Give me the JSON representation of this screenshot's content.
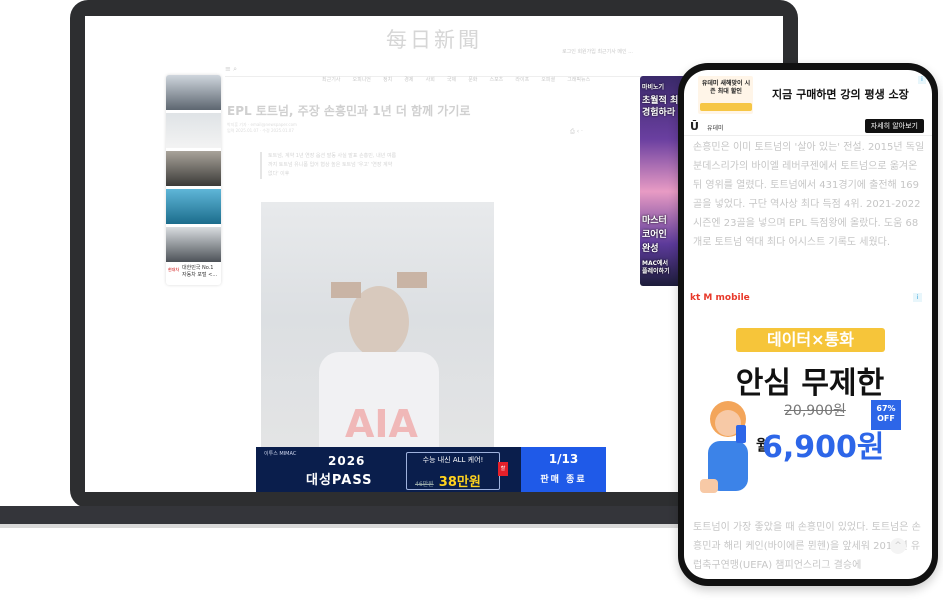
{
  "laptop": {
    "masthead": "每日新聞",
    "top_util": "로그인 회원가입 최근기사 메인 ...",
    "nav_items": [
      "최근기사",
      "오피니언",
      "정치",
      "경제",
      "사회",
      "국제",
      "문화",
      "스포츠",
      "라이프",
      "오피셜",
      "그래픽뉴스"
    ],
    "nav_icons": "≡  ⌕",
    "article_title": "EPL 토트넘, 주장 손흥민과 1년 더 함께 가기로",
    "byline_1": "박지훈 기자 · email@newspaper.com",
    "byline_2": "입력 2025.01.07 · 수정 2025.01.07",
    "share": "⎙  ‹  ·",
    "summary": "토트넘, 계약 1년 연장 옵션 발동 사실 발표 손흥민, 내년 여름까지 토트넘 유니폼 입어 협상 높은 토트넘 '우고' '연장 계약 없다' 이후",
    "left_ad": {
      "logo": "현대차",
      "text_1": "대한민국 No.1",
      "text_2": "자동차 포털 <..."
    },
    "right_ad": {
      "lines": [
        "마비노기",
        "초월적 최",
        "경험하라",
        "마스터",
        "코어인",
        "완성",
        "MAC에서",
        "플레이하기"
      ]
    },
    "bottom_banner": {
      "brand": "이투스 MIMAC",
      "year": "2026",
      "pass": "대성PASS",
      "top_text": "수능 내신 ALL 케어!",
      "old_price": "46만원",
      "new_price": "38만원",
      "badge": "할",
      "date": "1/13",
      "end_text": "판매 종료"
    }
  },
  "phone": {
    "ad": {
      "box_label": "유데미 새해맞이 시즌 최대 할인",
      "headline": "지금 구매하면 강의 평생 소장",
      "info": "i"
    },
    "brand_icon": "Ū",
    "brand": "유데미",
    "brand_button": "자세히 알아보기",
    "paragraph_1": "손흥민은 이미 토트넘의 '살아 있는' 전설. 2015년 독일 분데스리가의 바이엘 레버쿠젠에서 토트넘으로 옮겨온 뒤 영위를 열렸다. 토트넘에서 431경기에 출전해 169골을 넣었다. 구단 역사상 최다 득점 4위. 2021-2022시즌엔 23골을 넣으며 EPL 득점왕에 올랐다. 도움 68개로 토트넘 역대 최다 어시스트 기록도 세웠다.",
    "kt_logo": "kt M mobile",
    "kt_info": "i",
    "pill": "데이터×통화",
    "big": "안심 무제한",
    "old_price": "20,900원",
    "off": "67% OFF",
    "new_pre": "월",
    "new_price": "6,900원",
    "paragraph_2": "토트넘이 가장 좋았을 때 손흥민이 있었다. 토트넘은 손흥민과 해리 케인(바이에른 뮌헨)을 앞세워 2019년 유럽축구연맹(UEFA) 챔피언스리그 결승에",
    "scroll_up": "^"
  }
}
